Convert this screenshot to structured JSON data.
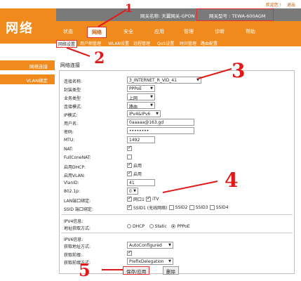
{
  "top_links": {
    "welcome": "欢迎您 !",
    "logout": "退出"
  },
  "logo": "网络",
  "infobar": {
    "gateway_name": "网关名称: 天翼网关-GPON",
    "gateway_model": "网关型号 : TEWA-600AGM"
  },
  "nav": {
    "tabs": [
      "状态",
      "网络",
      "安全",
      "应用",
      "管理",
      "诊断",
      "帮助"
    ]
  },
  "subnav": {
    "items": [
      "网络设置",
      "用户侧管理",
      "WLAN设置",
      "远程管理",
      "QoS设置",
      "时间管理",
      "路由配置"
    ]
  },
  "left": {
    "items": [
      "网络连接",
      "VLAN绑定"
    ]
  },
  "section_title": "网络连接",
  "form": {
    "conn_name_label": "连接名称:",
    "conn_name": "3_INTERNET_R_VID_41",
    "encap_label": "封装类型",
    "encap": "PPPoE",
    "service_label": "业务类型",
    "service": "上网",
    "conn_mode_label": "连接模式:",
    "conn_mode": "路由",
    "ip_mode_label": "IP模式:",
    "ip_mode": "IPv4&IPv6",
    "user_label": "用户名:",
    "user": "0aaaaa@163.gd",
    "pwd_label": "密码:",
    "pwd": "••••••••",
    "mtu_label": "MTU:",
    "mtu": "1492",
    "nat_label": "NAT:",
    "fullcone_label": "FullConeNAT:",
    "dhcp_label": "启用DHCP:",
    "dhcp_text": "启用",
    "vlan_enable_label": "启用VLAN:",
    "vlan_enable_text": "启用",
    "vlanid_label": "VlanID:",
    "vlanid": "41",
    "dot1p_label": "802.1p:",
    "dot1p": "0",
    "lan_bind_label": "LAN端口绑定:",
    "lan1": "网口1",
    "itv": "iTV",
    "ssid_bind_label": "SSID 端口绑定:",
    "ssid1": "SSID1 (无线网络)",
    "ssid2": "SSID2",
    "ssid3": "SSID3",
    "ssid4": "SSID4",
    "ipv4_title": "IPV4信息:",
    "ipv4_addr_label": "地址获取方式:",
    "dhcp_opt": "DHCP",
    "static_opt": "Static",
    "pppoe_opt": "PPPoE",
    "ipv6_title": "IPV6信息:",
    "ipv6_addr_label": "获取地址方式:",
    "ipv6_addr": "AutoConfigured",
    "prefix_label": "获取前缀:",
    "prefix_mode_label": "获取前缀方式:",
    "prefix_mode": "PrefixDelegation"
  },
  "buttons": {
    "save": "保存/应用",
    "delete": "删除"
  },
  "annotations": [
    "1",
    "2",
    "3",
    "4",
    "5"
  ],
  "colors": {
    "accent": "#f08a1c",
    "annotation": "#e01a1a"
  }
}
